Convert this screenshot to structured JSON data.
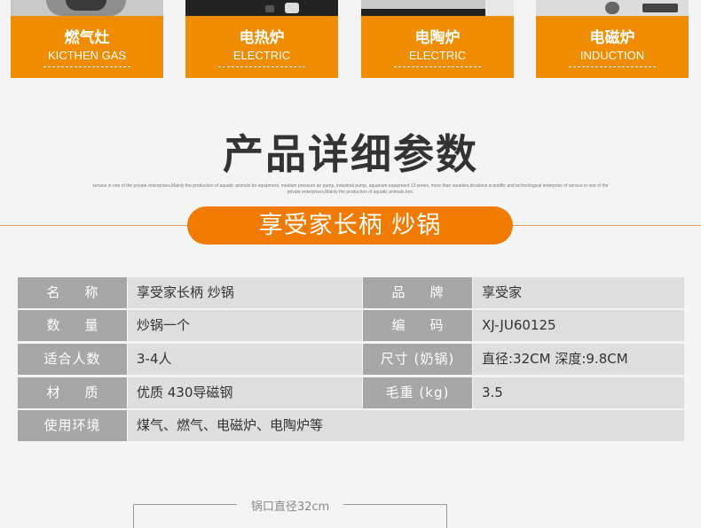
{
  "stove_cards": [
    {
      "title": "燃气灶",
      "sub": "KICTHEN GAS"
    },
    {
      "title": "电热炉",
      "sub": "ELECTRIC"
    },
    {
      "title": "电陶炉",
      "sub": "ELECTRIC"
    },
    {
      "title": "电磁炉",
      "sub": "INDUCTION"
    }
  ],
  "section": {
    "title": "产品详细参数",
    "fine_print": "service in one of the private enterprises,Mainly the production of aquatic animals bo equipment, medium pressure air pump, industrial pump, aquarium equipment 13 series, more than varieties,dications scientific and technological enterprise of service in one of the private enterprises,Mainly the production of aquatic animals box.",
    "product_name": "享受家长柄 炒锅"
  },
  "specs": {
    "rows": [
      {
        "l1": "名称",
        "v1": "享受家长柄 炒锅",
        "l2": "品牌",
        "v2": "享受家"
      },
      {
        "l1": "数量",
        "v1": "炒锅一个",
        "l2": "编码",
        "v2": "XJ-JU60125"
      },
      {
        "l1": "适合人数",
        "v1": "3-4人",
        "l2": "尺寸 (奶锅)",
        "v2": "直径:32CM 深度:9.8CM"
      },
      {
        "l1": "材质",
        "v1": "优质 430导磁钢",
        "l2": "毛重 (kg)",
        "v2": "3.5"
      }
    ],
    "env_label": "使用环境",
    "env_value": "煤气、燃气、电磁炉、电陶炉等"
  },
  "dimension": {
    "label": "锅口直径32cm"
  },
  "colors": {
    "accent": "#f07b00",
    "label_bg": "#a7a7a7",
    "value_bg": "#dedede"
  }
}
